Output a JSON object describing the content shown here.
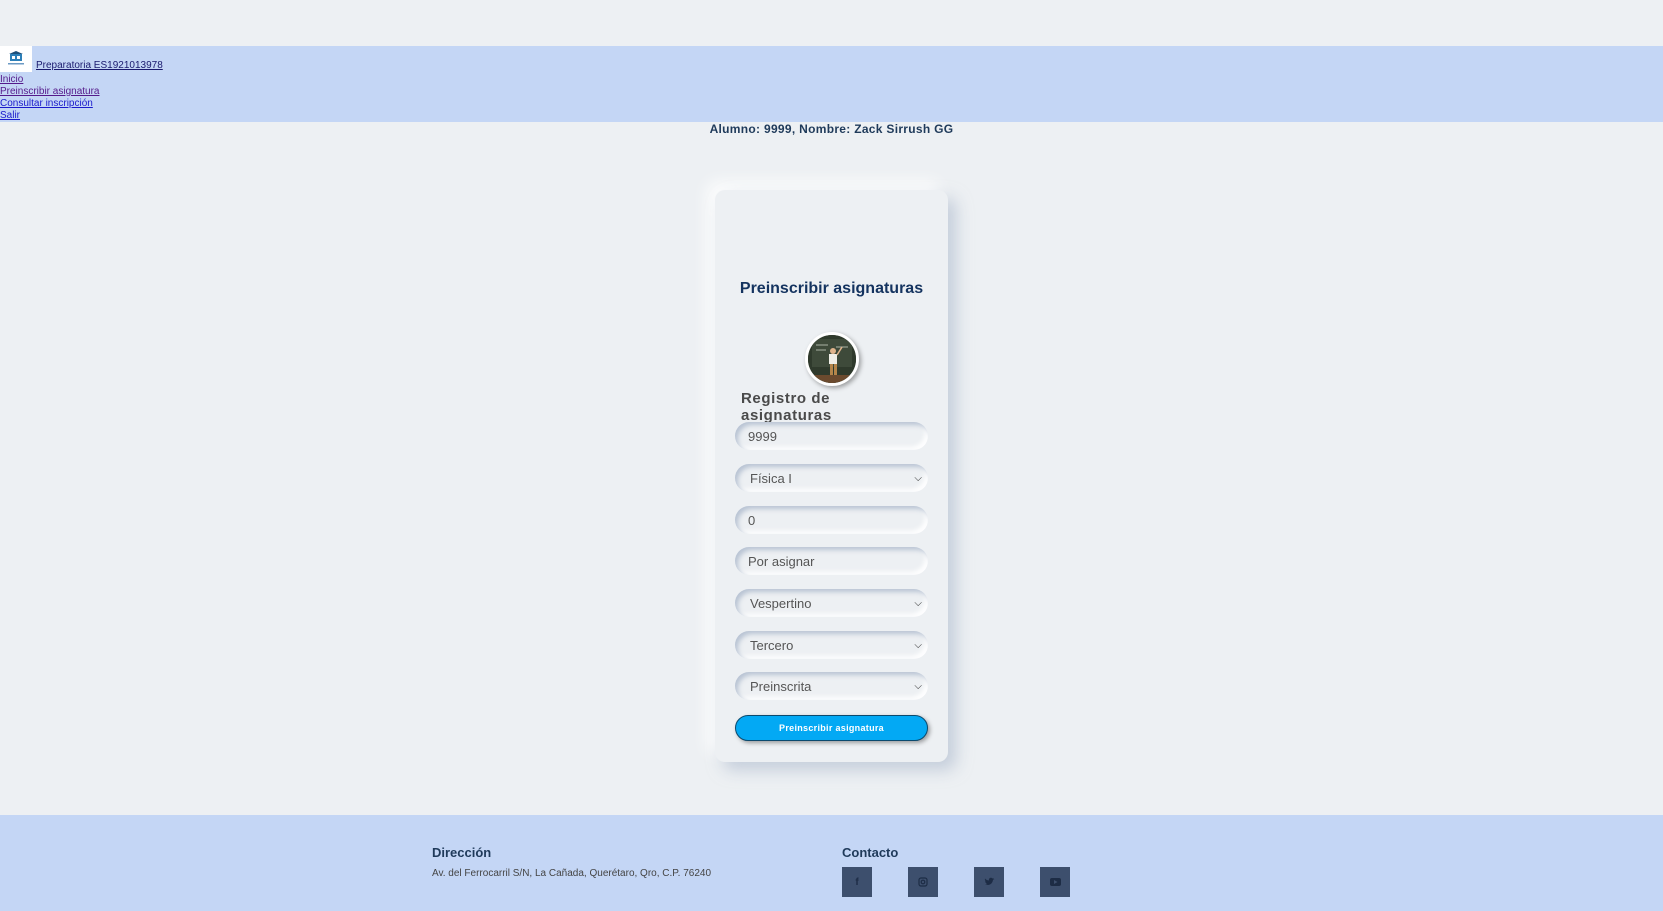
{
  "header": {
    "brand": "Preparatoria ES1921013978",
    "nav": [
      "Inicio",
      "Preinscribir asignatura",
      "Consultar inscripción",
      "Salir"
    ]
  },
  "student_line": "Alumno: 9999, Nombre: Zack Sirrush GG",
  "card": {
    "title": "Preinscribir asignaturas",
    "section": "Registro de asignaturas",
    "fields": {
      "student_id": "9999",
      "subject": "Física I",
      "grade": "0",
      "teacher": "Por asignar",
      "shift": "Vespertino",
      "semester": "Tercero",
      "status": "Preinscrita"
    },
    "submit": "Preinscribir asignatura"
  },
  "footer": {
    "address_title": "Dirección",
    "address": "Av. del Ferrocarril S/N, La Cañada, Querétaro, Qro, C.P. 76240",
    "contact_title": "Contacto",
    "social_icons": [
      "facebook-icon",
      "instagram-icon",
      "twitter-icon",
      "youtube-icon"
    ]
  },
  "colors": {
    "background": "#edf0f3",
    "header": "#c4d6f5",
    "accent": "#03a9f4",
    "title": "#14335f"
  }
}
